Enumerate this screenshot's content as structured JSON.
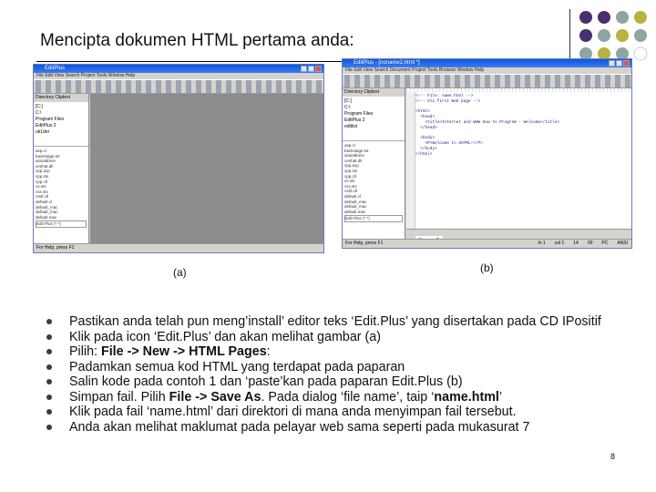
{
  "slide": {
    "title": "Mencipta dokumen HTML pertama anda:",
    "caption_a": "(a)",
    "caption_b": "(b)",
    "page_number": "8",
    "colors": {
      "dot_purple": "#4a2f6f",
      "dot_teal": "#8fa5a1",
      "dot_olive": "#b7b33c"
    }
  },
  "window_a": {
    "title": "EditPlus",
    "menu": "File  Edit  View  Search  Project  Tools  Window  Help",
    "side_tabs": "Directory   Cliptext",
    "drive": "[C:]",
    "tree": [
      "C:\\",
      "Program Files",
      "EditPlus 2",
      "uk1der"
    ],
    "files": [
      "asp.cl",
      "backstage.txt",
      "ansiabbrev",
      "cenhat.dil",
      "cpp.acp",
      "cpp.stx",
      "cpp.ctl",
      "cs.stx",
      "css.stx",
      "cstrl.ctl",
      "default.cl",
      "default_mac",
      "default_mac",
      "default.mac"
    ],
    "filter": "Edit Plus (*.*)",
    "status": "For Help, press F1"
  },
  "window_b": {
    "title": "EditPlus - [noname2.html *]",
    "menu": "File  Edit  View  Search  Document  Project  Tools  Browser  Window  Help",
    "side_tabs": "Directory   Cliptext",
    "drive": "[C:]",
    "tree": [
      "C:\\",
      "Program Files",
      "EditPlus 2",
      "editlist"
    ],
    "files": [
      "asp.cl",
      "backstage.txt",
      "ansiabbrev",
      "cenhat.dil",
      "cpp.acp",
      "cpp.stx",
      "cpp.ctl",
      "cs.stx",
      "css.stx",
      "cstrl.ctl",
      "default.cl",
      "default_mac",
      "default_mac",
      "default.mac"
    ],
    "filter": "Edit Plus (*.*)",
    "code": "<!-- File: name.html -->\n<!-- Oli first Web page -->\n\n<html>\n  <head>\n    <title>Internet and WWW How to Program - Welcome</title>\n  </head>\n\n  <body>\n    <P>Welcome to XHTML!</P>\n  </body>\n</html>",
    "doc_tab": "Noname2",
    "status_left": "For Help, press F1",
    "status_fields": [
      "In 1",
      "col 1",
      "14",
      "00",
      "PC",
      "ANSI"
    ]
  },
  "bullets": [
    {
      "pre": "Pastikan anda telah pun meng’install’ editor teks ‘Edit.Plus’ yang disertakan pada CD IPositif",
      "b1": "",
      "mid": "",
      "b2": "",
      "post": ""
    },
    {
      "pre": "Klik pada icon ‘Edit.Plus’ dan akan melihat gambar (a)",
      "b1": "",
      "mid": "",
      "b2": "",
      "post": ""
    },
    {
      "pre": "Pilih: ",
      "b1": "File -> New -> HTML Pages",
      "mid": ":",
      "b2": "",
      "post": ""
    },
    {
      "pre": "Padamkan semua kod HTML yang terdapat pada paparan",
      "b1": "",
      "mid": "",
      "b2": "",
      "post": ""
    },
    {
      "pre": "Salin kode pada contoh 1 dan ‘paste’kan pada paparan Edit.Plus (b)",
      "b1": "",
      "mid": "",
      "b2": "",
      "post": ""
    },
    {
      "pre": "Simpan fail. Pilih ",
      "b1": "File -> Save As",
      "mid": ". Pada dialog ‘file name’, taip ‘",
      "b2": "name.html",
      "post": "’"
    },
    {
      "pre": "Klik pada fail ‘name.html’ dari direktori di mana anda menyimpan fail tersebut.",
      "b1": "",
      "mid": "",
      "b2": "",
      "post": ""
    },
    {
      "pre": "Anda akan melihat maklumat pada pelayar web sama seperti pada mukasurat 7",
      "b1": "",
      "mid": "",
      "b2": "",
      "post": ""
    }
  ]
}
